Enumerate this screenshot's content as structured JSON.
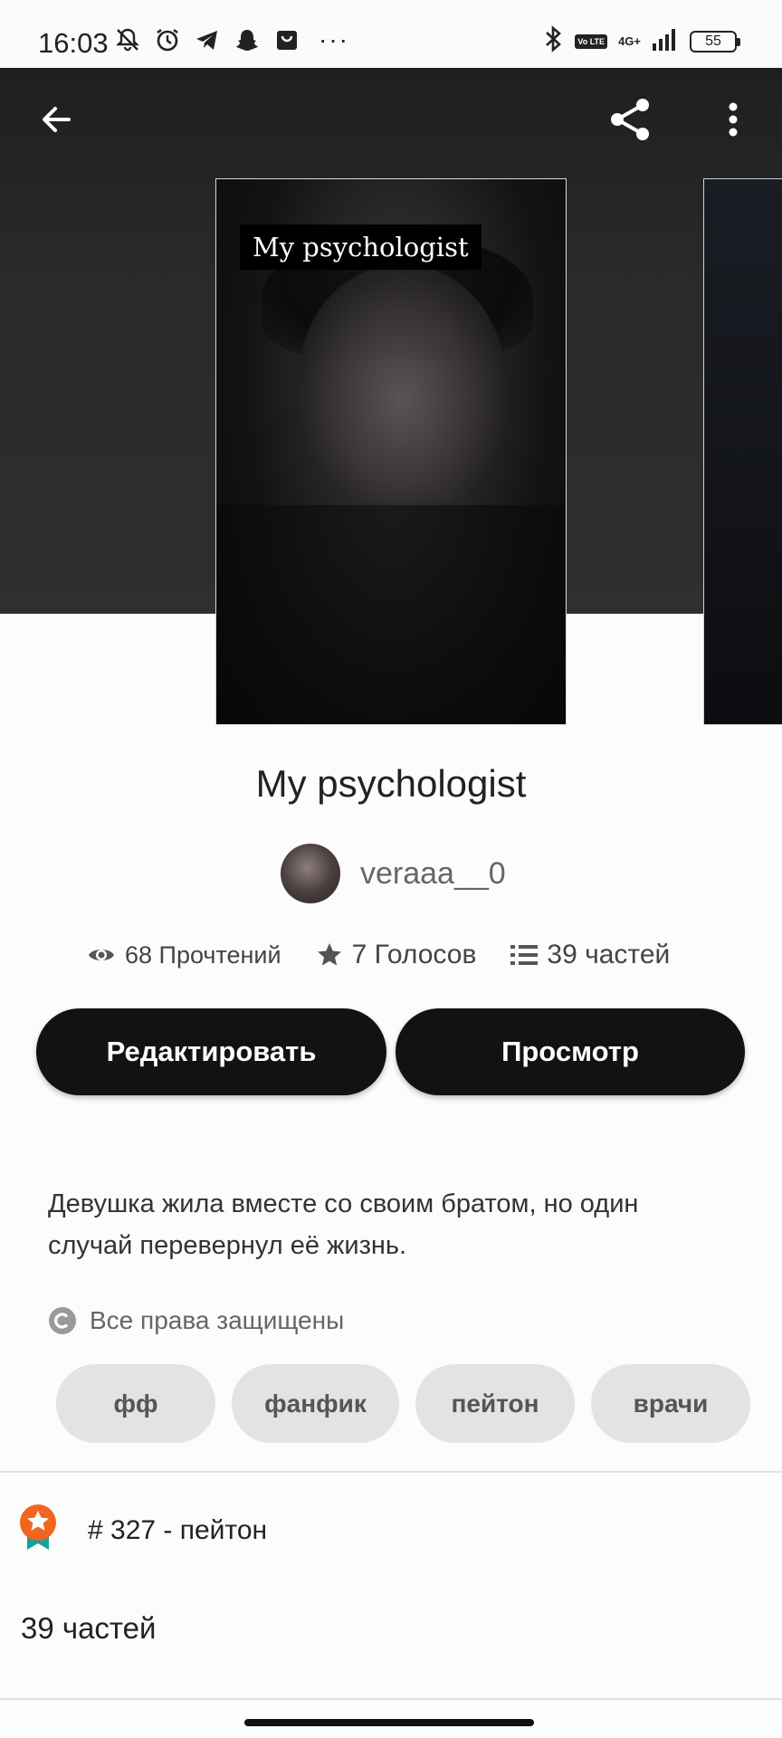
{
  "status_bar": {
    "time": "16:03",
    "left_icons": [
      "mute-bell-icon",
      "alarm-icon",
      "telegram-icon",
      "snapchat-icon",
      "shop-icon"
    ],
    "more": "···",
    "volte": "Vo LTE",
    "network": "4G+",
    "battery": "55"
  },
  "story": {
    "cover_title": "My psychologist",
    "title": "My psychologist",
    "author": "veraaa__0",
    "stats": {
      "reads": "68 Прочтений",
      "votes": "7 Голосов",
      "parts": "39 частей"
    },
    "buttons": {
      "edit": "Редактировать",
      "view": "Просмотр"
    },
    "description": "Девушка жила вместе со своим братом, но один случай перевернул её жизнь.",
    "copyright": "Все права защищены",
    "tags": [
      "фф",
      "фанфик",
      "пейтон",
      "врачи"
    ],
    "rank": "# 327 - пейтон",
    "parts_heading": "39 частей"
  },
  "colors": {
    "button_bg": "#121214",
    "tag_bg": "#e3e3e6",
    "rank_badge": "#f0651f"
  }
}
